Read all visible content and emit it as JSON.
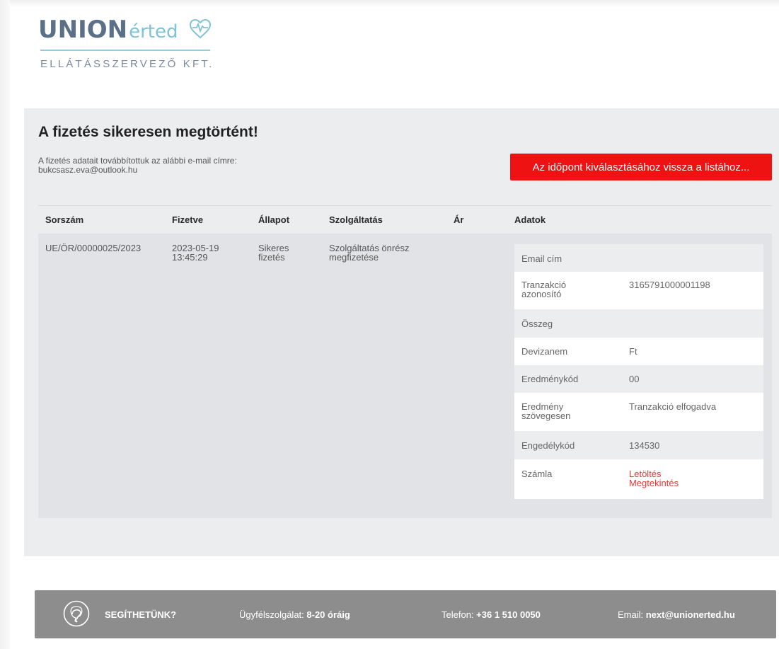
{
  "logo": {
    "brand_bold": "UNION",
    "brand_light": "érted",
    "subtitle": "ELLÁTÁSSZERVEZŐ KFT."
  },
  "page": {
    "title": "A fizetés sikeresen megtörtént!",
    "info_line1": "A fizetés adatait továbbítottuk az alábbi e-mail címre:",
    "info_email": "bukcsasz.eva@outlook.hu",
    "back_button": "Az időpont kiválasztásához vissza a listához..."
  },
  "table": {
    "headers": [
      "Sorszám",
      "Fizetve",
      "Állapot",
      "Szolgáltatás",
      "Ár",
      "Adatok"
    ],
    "row": {
      "sorszam": "UE/ÖR/00000025/2023",
      "fizetve_date": "2023-05-19",
      "fizetve_time": "13:45:29",
      "allapot_1": "Sikeres",
      "allapot_2": "fizetés",
      "szolg_1": "Szolgáltatás önrész",
      "szolg_2": "megfizetése",
      "ar": ""
    },
    "details": {
      "email_label": "Email cím",
      "email_value": "",
      "tranz_label_1": "Tranzakció",
      "tranz_label_2": "azonosító",
      "tranz_value": "3165791000001198",
      "osszeg_label": "Összeg",
      "osszeg_value": "",
      "deviza_label": "Devizanem",
      "deviza_value": "Ft",
      "eredmenykod_label": "Eredménykód",
      "eredmenykod_value": "00",
      "eredmeny_label_1": "Eredmény",
      "eredmeny_label_2": "szövegesen",
      "eredmeny_value": "Tranzakció elfogadva",
      "engedely_label": "Engedélykód",
      "engedely_value": "134530",
      "szamla_label": "Számla",
      "download_link": "Letöltés",
      "view_link": "Megtekintés"
    }
  },
  "footer": {
    "help": "SEGÍTHETÜNK?",
    "service_label": "Ügyfélszolgálat: ",
    "service_value": "8-20 óráig",
    "phone_label": "Telefon: ",
    "phone_value": "+36 1 510 0050",
    "email_label": "Email: ",
    "email_value": "next@unionerted.hu"
  },
  "colors": {
    "accent_red": "#ee1212",
    "link_red": "#e53838",
    "logo_blue": "#5a6f88",
    "logo_teal": "#7fc3d3",
    "footer_gray": "#8d8d8d"
  }
}
